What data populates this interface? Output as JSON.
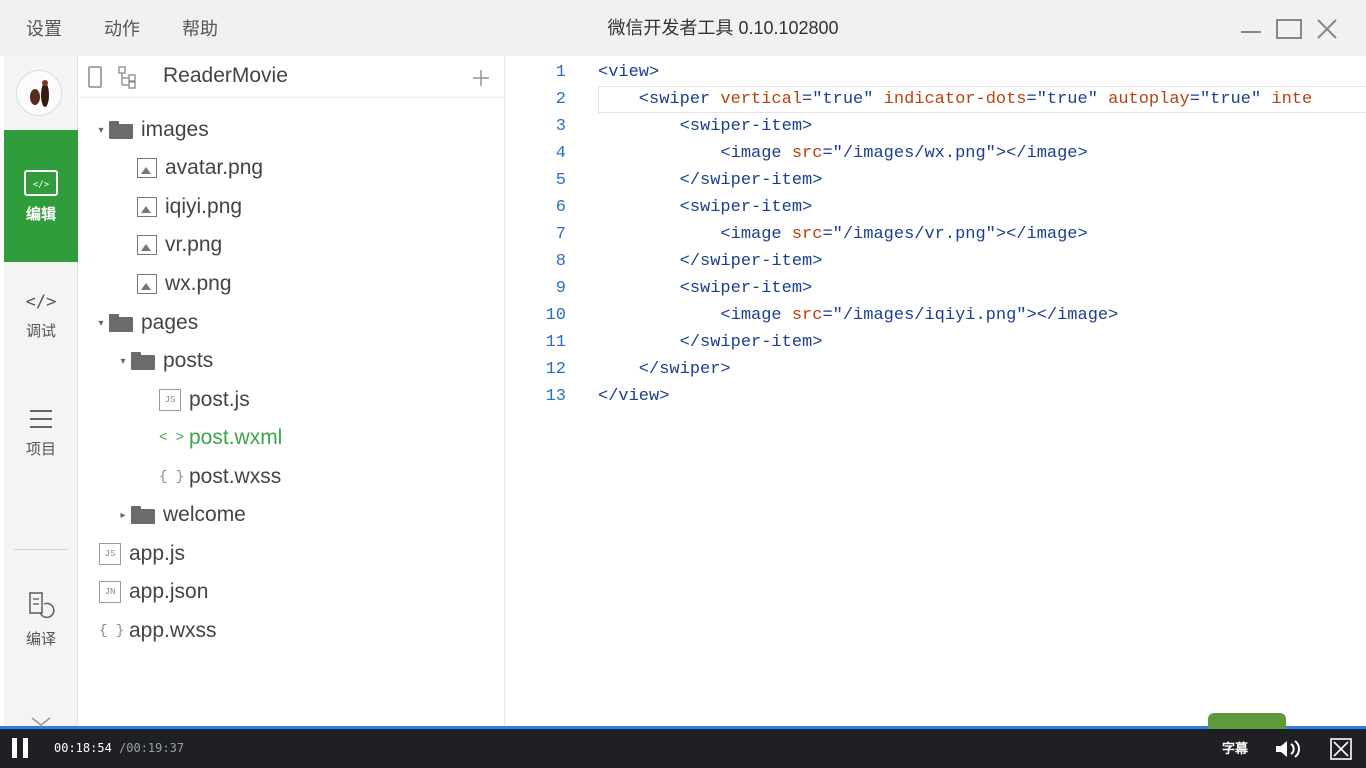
{
  "menu": [
    "设置",
    "动作",
    "帮助"
  ],
  "window_title": "微信开发者工具 0.10.102800",
  "rail": {
    "items": [
      {
        "label": "编辑",
        "icon": "editor-icon",
        "active": true
      },
      {
        "label": "调试",
        "icon": "code-brackets-icon",
        "active": false
      },
      {
        "label": "项目",
        "icon": "menu-lines-icon",
        "active": false
      },
      {
        "label": "编译",
        "icon": "compile-icon",
        "active": false
      }
    ]
  },
  "tree": {
    "project": "ReaderMovie",
    "items": [
      {
        "label": "images",
        "type": "folder",
        "expanded": true
      },
      {
        "label": "avatar.png",
        "type": "image"
      },
      {
        "label": "iqiyi.png",
        "type": "image"
      },
      {
        "label": "vr.png",
        "type": "image"
      },
      {
        "label": "wx.png",
        "type": "image"
      },
      {
        "label": "pages",
        "type": "folder",
        "expanded": true
      },
      {
        "label": "posts",
        "type": "folder",
        "expanded": true
      },
      {
        "label": "post.js",
        "type": "js"
      },
      {
        "label": "post.wxml",
        "type": "wxml",
        "selected": true
      },
      {
        "label": "post.wxss",
        "type": "wxss"
      },
      {
        "label": "welcome",
        "type": "folder",
        "expanded": false
      },
      {
        "label": "app.js",
        "type": "js"
      },
      {
        "label": "app.json",
        "type": "json"
      },
      {
        "label": "app.wxss",
        "type": "wxss"
      }
    ]
  },
  "editor": {
    "line_numbers": [
      "1",
      "2",
      "3",
      "4",
      "5",
      "6",
      "7",
      "8",
      "9",
      "10",
      "11",
      "12",
      "13"
    ],
    "lines": [
      "<view>",
      "    <swiper vertical=\"true\" indicator-dots=\"true\" autoplay=\"true\" inte",
      "        <swiper-item>",
      "            <image src=\"/images/wx.png\"></image>",
      "        </swiper-item>",
      "        <swiper-item>",
      "            <image src=\"/images/vr.png\"></image>",
      "        </swiper-item>",
      "        <swiper-item>",
      "            <image src=\"/images/iqiyi.png\"></image>",
      "        </swiper-item>",
      "    </swiper>",
      "</view>"
    ]
  },
  "player": {
    "current_time": "00:18:54",
    "total_time": "/00:19:37",
    "subtitle_label": "字幕",
    "progress": 0.963
  },
  "colors": {
    "accent_green": "#2f9d3b",
    "tag_blue": "#1b3f8f",
    "attr_orange": "#b8420e",
    "player_bg": "#1e2023",
    "progress_blue": "#2b7de9"
  }
}
